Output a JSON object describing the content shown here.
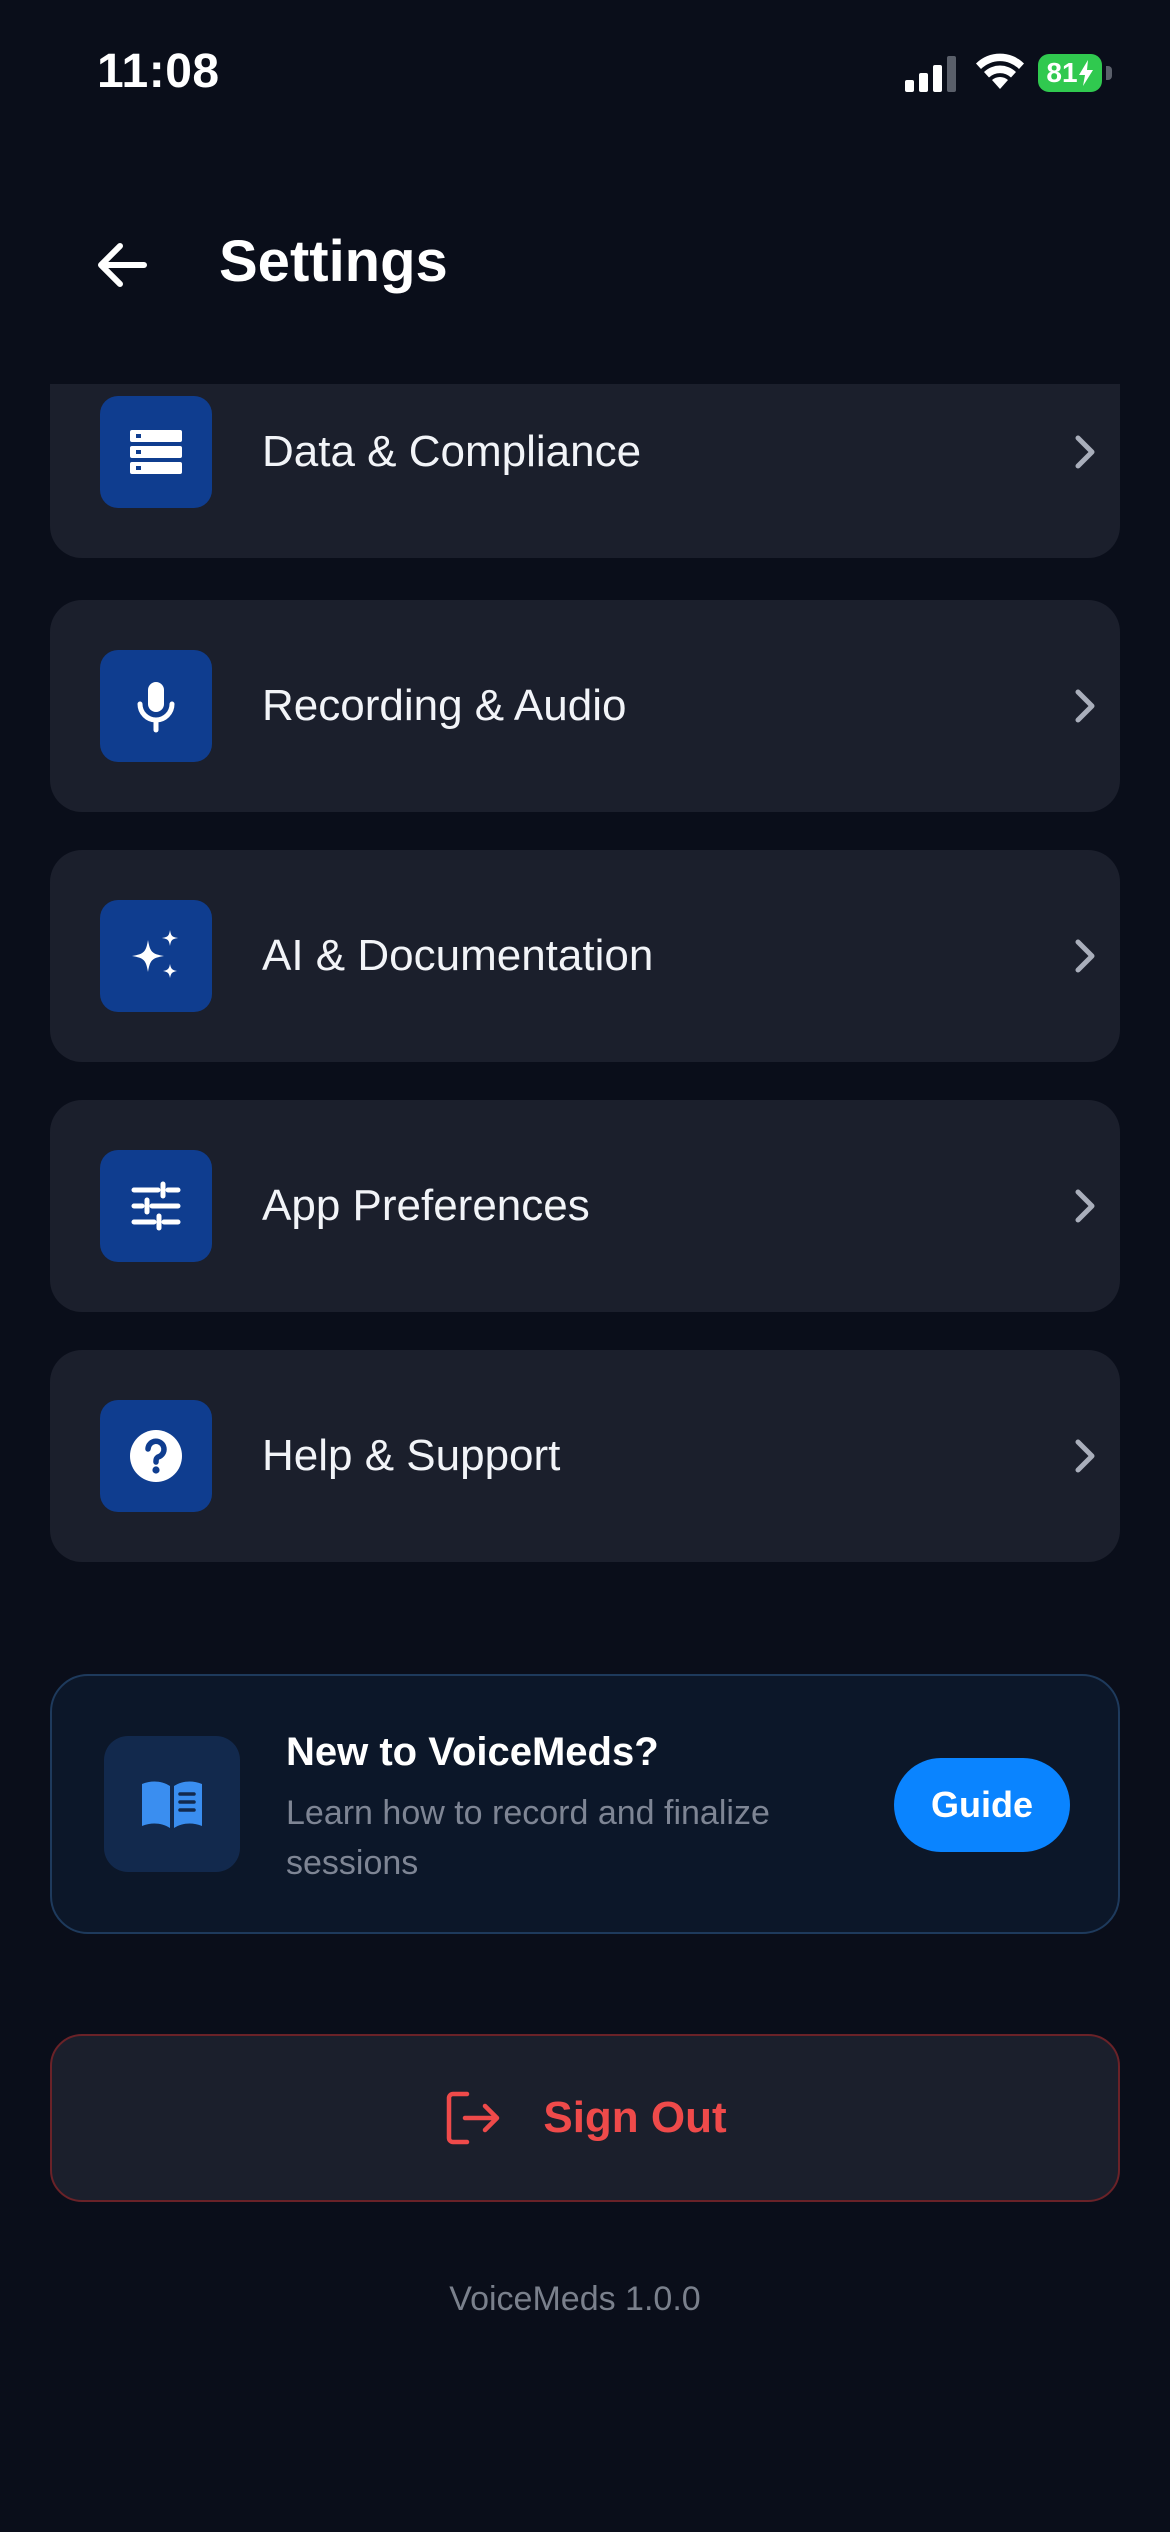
{
  "status_bar": {
    "time": "11:08",
    "battery_level": "81",
    "battery_charging": true,
    "battery_color": "#30c94f"
  },
  "header": {
    "title": "Settings",
    "back_icon": "arrow-left-icon"
  },
  "settings_items": [
    {
      "label": "Data & Compliance",
      "icon": "database-icon"
    },
    {
      "label": "Recording & Audio",
      "icon": "microphone-icon"
    },
    {
      "label": "AI & Documentation",
      "icon": "sparkles-icon"
    },
    {
      "label": "App Preferences",
      "icon": "sliders-icon"
    },
    {
      "label": "Help & Support",
      "icon": "help-circle-icon"
    }
  ],
  "guide": {
    "title": "New to VoiceMeds?",
    "subtitle": "Learn how to record and finalize sessions",
    "button_label": "Guide",
    "icon": "book-open-icon"
  },
  "sign_out": {
    "label": "Sign Out",
    "icon": "logout-icon",
    "color": "#ef4a4a"
  },
  "version": "VoiceMeds 1.0.0",
  "colors": {
    "background": "#0a0e1a",
    "card": "#1b1f2c",
    "icon_box": "#0f3d8f",
    "accent": "#0a84ff"
  }
}
